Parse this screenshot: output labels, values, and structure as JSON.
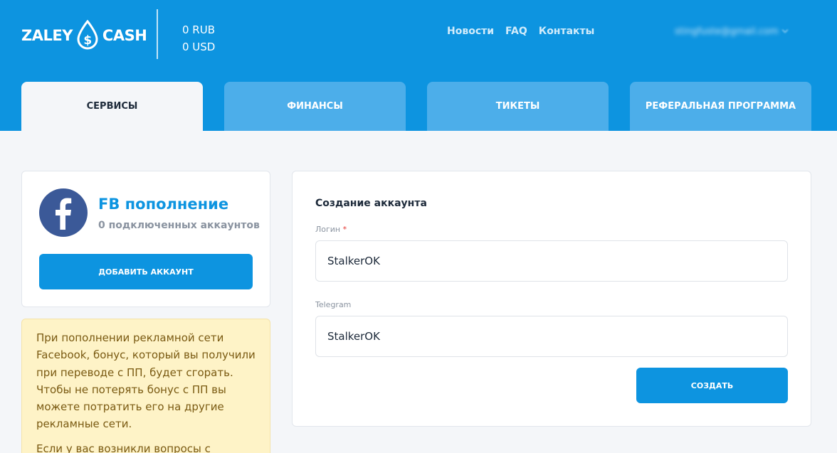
{
  "brand": {
    "left": "ZALEY",
    "right": "CASH"
  },
  "balance": {
    "rub": "0 RUB",
    "usd": "0 USD"
  },
  "nav": [
    "Новости",
    "FAQ",
    "Контакты"
  ],
  "user": {
    "email": "stingfuste@gmail.com"
  },
  "tabs": [
    {
      "label": "СЕРВИСЫ",
      "active": true
    },
    {
      "label": "ФИНАНСЫ",
      "active": false
    },
    {
      "label": "ТИКЕТЫ",
      "active": false
    },
    {
      "label": "РЕФЕРАЛЬНАЯ ПРОГРАММА",
      "active": false
    }
  ],
  "service": {
    "title": "FB пополнение",
    "subtitle": "0 подключенных аккаунтов",
    "add_button": "ДОБАВИТЬ АККАУНТ"
  },
  "notice": {
    "paragraph1": "При пополнении рекламной сети Facebook, бонус, который вы получили при переводе с ПП, будет сгорать. Чтобы не потерять бонус с ПП вы можете потратить его на другие рекламные сети.",
    "paragraph2": "Если у вас возникли вопросы с"
  },
  "form": {
    "title": "Создание аккаунта",
    "login_label": "Логин",
    "required_mark": "*",
    "login_value": "StalkerOK",
    "telegram_label": "Telegram",
    "telegram_value": "StalkerOK",
    "submit": "СОЗДАТЬ"
  },
  "colors": {
    "primary": "#0d94e0",
    "tab": "#4caeea",
    "facebook": "#3b5998",
    "notice_bg": "#fef3c7"
  }
}
